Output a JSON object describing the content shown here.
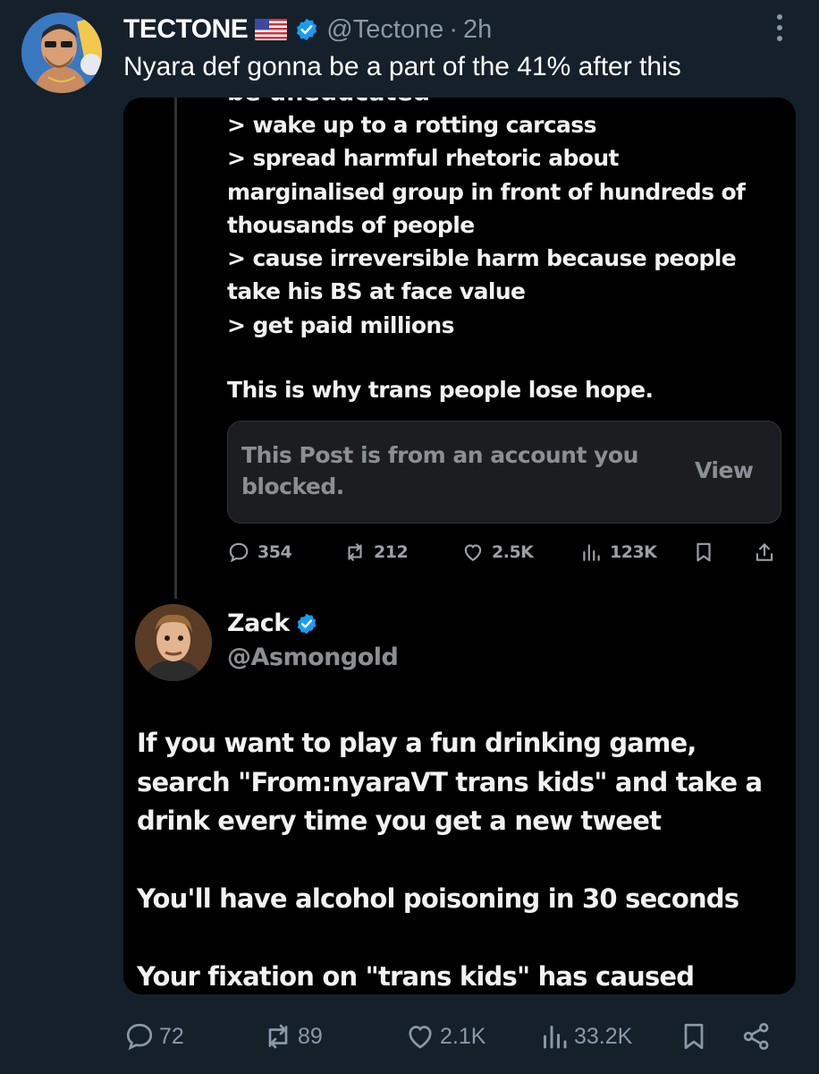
{
  "post": {
    "display_name": "TECTONE",
    "handle": "@Tectone",
    "separator": "·",
    "time": "2h",
    "text": "Nyara def gonna be a part of the 41% after this"
  },
  "media": {
    "cut_top_text": "be uneducated",
    "lines": [
      "> wake up to a rotting carcass",
      "> spread harmful rhetoric about",
      "marginalised group in front of hundreds of",
      "thousands of people",
      "> cause irreversible harm because people",
      "take his BS at face value",
      "> get paid millions"
    ],
    "conclusion": "This is why trans people lose hope.",
    "blocked_notice": "This Post is from an account you blocked.",
    "view_label": "View",
    "inner_stats": {
      "replies": "354",
      "reposts": "212",
      "likes": "2.5K",
      "views": "123K"
    },
    "quote": {
      "name": "Zack",
      "handle": "@Asmongold",
      "lines": [
        "If you want to play a fun drinking game,",
        "search \"From:nyaraVT trans kids\" and take a",
        "drink every time you get a new tweet",
        "",
        "You'll have alcohol poisoning in 30 seconds",
        "",
        "Your fixation on \"trans kids\" has caused"
      ]
    }
  },
  "stats": {
    "replies": "72",
    "reposts": "89",
    "likes": "2.1K",
    "views": "33.2K"
  },
  "colors": {
    "background": "#15202b",
    "muted": "#8b98a5",
    "verified": "#1d9bf0"
  }
}
